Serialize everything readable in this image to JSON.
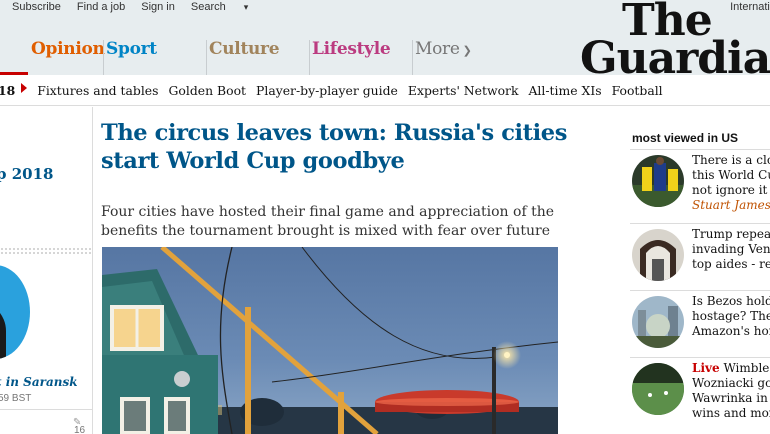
{
  "top_links": {
    "subscribe": "Subscribe",
    "find_job": "Find a job",
    "sign_in": "Sign in",
    "search": "Search",
    "international": "Internatio"
  },
  "pillars": {
    "opinion": "Opinion",
    "sport": "Sport",
    "culture": "Culture",
    "lifestyle": "Lifestyle",
    "more": "More"
  },
  "logo": {
    "line1": "The",
    "line2": "Guardian"
  },
  "subnav": {
    "prefix": "18",
    "items": [
      "Fixtures and tables",
      "Golden Boot",
      "Player-by-player guide",
      "Experts' Network",
      "All-time XIs",
      "Football"
    ]
  },
  "left_column": {
    "title": "p 2018",
    "caption": "t in Saransk",
    "time": "59 BST",
    "comment_count": "16"
  },
  "article": {
    "headline": "The circus leaves town: Russia's cities start World Cup goodbye",
    "standfirst": "Four cities have hosted their final game and appreciation of the benefits the tournament brought is mixed with fear over future"
  },
  "most_viewed": {
    "title": "most viewed in US",
    "items": [
      {
        "lines": [
          "There is a cloud",
          "this World Cup",
          "not ignore it"
        ],
        "byline": "Stuart James in"
      },
      {
        "lines": [
          "Trump repeate",
          "invading Venez",
          "top aides - repo"
        ],
        "byline": ""
      },
      {
        "lines": [
          "Is Bezos holdin",
          "hostage? The c",
          "Amazon's hom"
        ],
        "byline": ""
      },
      {
        "live": "Live",
        "lines": [
          "Wimbledo",
          "Wozniacki goe",
          "Wawrinka in tr",
          "wins and more"
        ],
        "byline": ""
      }
    ]
  },
  "colors": {
    "topbar_bg": "#e7edef",
    "opinion": "#e05e00",
    "sport": "#0084c6",
    "culture": "#a1845c",
    "lifestyle": "#bb3b80",
    "headline": "#005689",
    "red_accent": "#c70000"
  }
}
